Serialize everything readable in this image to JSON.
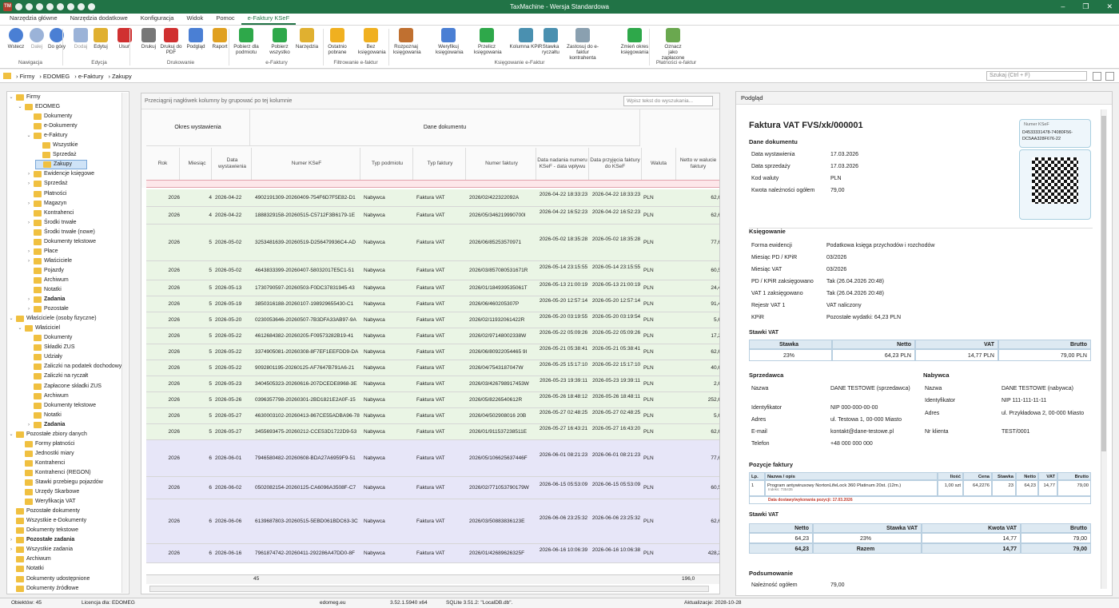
{
  "app": {
    "title": "TaxMachine - Wersja Standardowa"
  },
  "menu": [
    "Narzędzia główne",
    "Narzędzia dodatkowe",
    "Konfiguracja",
    "Widok",
    "Pomoc",
    "e-Faktury KSeF"
  ],
  "ribbon": {
    "buttons": [
      "Wstecz",
      "Dalej",
      "Do góry",
      "Dodaj",
      "Edytuj",
      "Usuń",
      "Drukuj",
      "Drukuj do PDF",
      "Podgląd",
      "Raport",
      "Pobierz dla podmiotu",
      "Pobierz wszystko",
      "Narzędzia",
      "Ostatnio pobrane",
      "Bez księgowania",
      "Rozpoznaj księgowania",
      "Weryfikuj księgowania",
      "Przelicz księgowania",
      "Kolumna KPiR",
      "Stawka ryczałtu",
      "Zastosuj do e-faktur kontrahenta",
      "Zmień okres księgowania",
      "Oznacz jako zapłacone"
    ],
    "groups": [
      "Nawigacja",
      "Edycja",
      "Drukowanie",
      "e-Faktury",
      "Filtrowanie e-faktur",
      "Księgowanie e-Faktur",
      "Płatności e-faktur"
    ]
  },
  "path": [
    "Firmy",
    "EDOMEG",
    "e-Faktury",
    "Zakupy"
  ],
  "search_placeholder": "Szukaj (Ctrl + F)",
  "tree": [
    {
      "l": "Firmy",
      "d": 0,
      "e": "v"
    },
    {
      "l": "EDOMEG",
      "d": 1,
      "e": "v"
    },
    {
      "l": "Dokumenty",
      "d": 2
    },
    {
      "l": "e-Dokumenty",
      "d": 2
    },
    {
      "l": "e-Faktury",
      "d": 2,
      "e": "v"
    },
    {
      "l": "Wszystkie",
      "d": 3
    },
    {
      "l": "Sprzedaż",
      "d": 3
    },
    {
      "l": "Zakupy",
      "d": 3,
      "sel": true
    },
    {
      "l": "Ewidencje księgowe",
      "d": 2,
      "e": ">"
    },
    {
      "l": "Sprzedaż",
      "d": 2,
      "e": ">"
    },
    {
      "l": "Płatności",
      "d": 2
    },
    {
      "l": "Magazyn",
      "d": 2,
      "e": ">"
    },
    {
      "l": "Kontrahenci",
      "d": 2
    },
    {
      "l": "Środki trwałe",
      "d": 2,
      "e": ">"
    },
    {
      "l": "Środki trwałe (nowe)",
      "d": 2
    },
    {
      "l": "Dokumenty tekstowe",
      "d": 2
    },
    {
      "l": "Płace",
      "d": 2,
      "e": ">"
    },
    {
      "l": "Właściciele",
      "d": 2,
      "e": ">"
    },
    {
      "l": "Pojazdy",
      "d": 2
    },
    {
      "l": "Archiwum",
      "d": 2
    },
    {
      "l": "Notatki",
      "d": 2
    },
    {
      "l": "Zadania",
      "d": 2,
      "e": ">",
      "b": true
    },
    {
      "l": "Pozostałe",
      "d": 2,
      "e": ">"
    },
    {
      "l": "Właściciele (osoby fizyczne)",
      "d": 0,
      "e": "v"
    },
    {
      "l": "Właściciel",
      "d": 1,
      "e": "v"
    },
    {
      "l": "Dokumenty",
      "d": 2
    },
    {
      "l": "Składki ZUS",
      "d": 2
    },
    {
      "l": "Udziały",
      "d": 2
    },
    {
      "l": "Zaliczki na podatek dochodowy",
      "d": 2
    },
    {
      "l": "Zaliczki na ryczałt",
      "d": 2
    },
    {
      "l": "Zapłacone składki ZUS",
      "d": 2
    },
    {
      "l": "Archiwum",
      "d": 2
    },
    {
      "l": "Dokumenty tekstowe",
      "d": 2
    },
    {
      "l": "Notatki",
      "d": 2
    },
    {
      "l": "Zadania",
      "d": 2,
      "e": ">",
      "b": true
    },
    {
      "l": "Pozostałe zbiory danych",
      "d": 0,
      "e": "v"
    },
    {
      "l": "Formy płatności",
      "d": 1
    },
    {
      "l": "Jednostki miary",
      "d": 1
    },
    {
      "l": "Kontrahenci",
      "d": 1
    },
    {
      "l": "Kontrahenci (REGON)",
      "d": 1
    },
    {
      "l": "Stawki przebiegu pojazdów",
      "d": 1
    },
    {
      "l": "Urzędy Skarbowe",
      "d": 1
    },
    {
      "l": "Weryfikacja VAT",
      "d": 1
    },
    {
      "l": "Pozostałe dokumenty",
      "d": 0
    },
    {
      "l": "Wszystkie e-Dokumenty",
      "d": 0
    },
    {
      "l": "Dokumenty tekstowe",
      "d": 0
    },
    {
      "l": "Pozostałe zadania",
      "d": 0,
      "e": ">",
      "b": true
    },
    {
      "l": "Wszystkie zadania",
      "d": 0,
      "e": ">"
    },
    {
      "l": "Archiwum",
      "d": 0
    },
    {
      "l": "Notatki",
      "d": 0
    },
    {
      "l": "Dokumenty udostępnione",
      "d": 0
    },
    {
      "l": "Dokumenty źródłowe",
      "d": 0
    }
  ],
  "grid": {
    "group_hint": "Przeciągnij nagłówek kolumny by grupować po tej kolumnie",
    "search_placeholder": "Wpisz tekst do wyszukania...",
    "band1": "Okres wystawienia",
    "band2": "Dane dokumentu",
    "columns": [
      "Rok",
      "Miesiąc",
      "Data wystawienia",
      "Numer KSeF",
      "Typ podmiotu",
      "Typ faktury",
      "Numer faktury",
      "Data nadania numeru KSeF - data wpływu",
      "Data przyjęcia faktury do KSeF",
      "Waluta",
      "Netto w walucie faktury"
    ],
    "rows": [
      [
        "2026",
        "4",
        "2026-04-22",
        "4902191309-20260409-754F6D7F5E82-D1",
        "Nabywca",
        "Faktura VAT",
        "2026/02/422322092A",
        "2026-04-22 18:33:23",
        "2026-04-22 18:33:23",
        "PLN",
        "62,6"
      ],
      [
        "2026",
        "4",
        "2026-04-22",
        "1888329158-20260515-C5712F3B6179-1E",
        "Nabywca",
        "Faktura VAT",
        "2026/05/346219990700I",
        "2026-04-22 16:52:23",
        "2026-04-22 16:52:23",
        "PLN",
        "62,6"
      ],
      [
        "2026",
        "5",
        "2026-05-02",
        "3253481639-20260519-D256479936C4-AD",
        "Nabywca",
        "Faktura VAT",
        "2026/06/85253570971",
        "2026-05-02 18:35:28",
        "2026-05-02 18:35:28",
        "PLN",
        "77,6"
      ],
      [
        "2026",
        "5",
        "2026-05-02",
        "4643833399-20260407-58032017E5C1-51",
        "Nabywca",
        "Faktura VAT",
        "2026/03/857080531671R",
        "2026-05-14 23:15:55",
        "2026-05-14 23:15:55",
        "PLN",
        "60,5"
      ],
      [
        "2026",
        "5",
        "2026-05-13",
        "1730790597-20260503-F0DC37831945-43",
        "Nabywca",
        "Faktura VAT",
        "2026/01/184939535061T",
        "2026-05-13 21:00:19",
        "2026-05-13 21:00:19",
        "PLN",
        "24,4"
      ],
      [
        "2026",
        "5",
        "2026-05-19",
        "3850316188-20260107-198929655430-C1",
        "Nabywca",
        "Faktura VAT",
        "2026/06/460205307P",
        "2026-05-20 12:57:14",
        "2026-05-20 12:57:14",
        "PLN",
        "91,4"
      ],
      [
        "2026",
        "5",
        "2026-05-20",
        "0230053646-20260507-7B3DFA33AB97-9A",
        "Nabywca",
        "Faktura VAT",
        "2026/02/11932061422R",
        "2026-05-20 03:19:55",
        "2026-05-20 03:19:54",
        "PLN",
        "5,6"
      ],
      [
        "2026",
        "5",
        "2026-05-22",
        "4612684382-20260205-F09573282B19-41",
        "Nabywca",
        "Faktura VAT",
        "2026/02/97148002338W",
        "2026-05-22 05:09:26",
        "2026-05-22 05:09:26",
        "PLN",
        "17,2"
      ],
      [
        "2026",
        "5",
        "2026-05-22",
        "3374905081-20260308-8F7EF1EEFDD9-DA",
        "Nabywca",
        "Faktura VAT",
        "2026/06/80922054465 9I",
        "2026-05-21 05:38:41",
        "2026-05-21 05:38:41",
        "PLN",
        "62,6"
      ],
      [
        "2026",
        "5",
        "2026-05-22",
        "9092801195-20260125-AF7647B791A6-21",
        "Nabywca",
        "Faktura VAT",
        "2026/04/7543187047W",
        "2026-05-25 15:17:10",
        "2026-05-22 15:17:10",
        "PLN",
        "40,6"
      ],
      [
        "2026",
        "5",
        "2026-05-23",
        "3404505323-20260616-207DCEDE8968-3E",
        "Nabywca",
        "Faktura VAT",
        "2026/03/426798917453W",
        "2026-05-23 19:39:11",
        "2026-05-23 19:39:11",
        "PLN",
        "2,6"
      ],
      [
        "2026",
        "5",
        "2026-05-26",
        "0396357798-20260301-2BD1821E2A0F-15",
        "Nabywca",
        "Faktura VAT",
        "2026/05/8226540612R",
        "2026-05-26 18:48:12",
        "2026-05-26 18:48:11",
        "PLN",
        "252,6"
      ],
      [
        "2026",
        "5",
        "2026-05-27",
        "4630003102-20260413-867CE55ADBA96-78",
        "Nabywca",
        "Faktura VAT",
        "2026/04/502908016 20B",
        "2026-05-27 02:48:25",
        "2026-05-27 02:48:25",
        "PLN",
        "5,6"
      ],
      [
        "2026",
        "5",
        "2026-05-27",
        "3455693475-20260212-CCE53D1722D9-53",
        "Nabywca",
        "Faktura VAT",
        "2026/01/911537238511E",
        "2026-05-27 16:43:21",
        "2026-05-27 16:43:20",
        "PLN",
        "62,6"
      ],
      [
        "2026",
        "6",
        "2026-06-01",
        "7946580482-20260608-BDA27A6959F9-51",
        "Nabywca",
        "Faktura VAT",
        "2026/05/106625637446F",
        "2026-06-01 08:21:23",
        "2026-06-01 08:21:23",
        "PLN",
        "77,6"
      ],
      [
        "2026",
        "6",
        "2026-06-02",
        "0502082154-20260125-CA6096A3508F-C7",
        "Nabywca",
        "Faktura VAT",
        "2026/02/771053790179W",
        "2026-06-15 05:53:09",
        "2026-06-15 05:53:09",
        "PLN",
        "60,5"
      ],
      [
        "2026",
        "6",
        "2026-06-06",
        "6139687803-20260515-5EBD061BDC63-3C",
        "Nabywca",
        "Faktura VAT",
        "2026/03/50883836123E",
        "2026-06-06 23:25:32",
        "2026-06-06 23:25:32",
        "PLN",
        "62,6"
      ],
      [
        "2026",
        "6",
        "2026-06-16",
        "7961874742-20260411-292286A47DD0-8F",
        "Nabywca",
        "Faktura VAT",
        "2026/01/42689626325F",
        "2026-06-16 10:06:39",
        "2026-06-16 10:06:38",
        "PLN",
        "428,2"
      ]
    ],
    "footer_count": "45",
    "footer_sum": "196,0"
  },
  "preview": {
    "panel": "Podgląd",
    "title": "Faktura VAT FVS/xk/000001",
    "ksef_label": "Numer KSeF",
    "ksef_num": "D4533331478-74080F56-DC5AA328F676-22",
    "s_dane": "Dane dokumentu",
    "dane": [
      [
        "Data wystawienia",
        "17.03.2026"
      ],
      [
        "Data sprzedaży",
        "17.03.2026"
      ],
      [
        "Kod waluty",
        "PLN"
      ],
      [
        "Kwota należności ogółem",
        "79,00"
      ]
    ],
    "s_ksieg": "Księgowanie",
    "ksieg": [
      [
        "Forma ewidencji",
        "Podatkowa księga przychodów i rozchodów"
      ],
      [
        "Miesiąc PD / KPiR",
        "03/2026"
      ],
      [
        "Miesiąc VAT",
        "03/2026"
      ],
      [
        "PD / KPiR zaksięgowano",
        "Tak (26.04.2026 20:48)"
      ],
      [
        "VAT 1 zaksięgowano",
        "Tak (26.04.2026 20:48)"
      ],
      [
        "Rejestr VAT 1",
        "VAT naliczony"
      ],
      [
        "KPiR",
        "Pozostałe wydatki: 64,23 PLN"
      ]
    ],
    "s_stawki": "Stawki VAT",
    "st_head": [
      "Stawka",
      "Netto",
      "VAT",
      "Brutto"
    ],
    "st_row": [
      "23%",
      "64,23 PLN",
      "14,77 PLN",
      "79,00 PLN"
    ],
    "s_sprz": "Sprzedawca",
    "s_nab": "Nabywca",
    "sprz": [
      [
        "Nazwa",
        "DANE TESTOWE (sprzedawca)"
      ],
      [
        "Identyfikator",
        "NIP 000-000-00-00"
      ],
      [
        "Adres",
        "ul. Testowa 1, 00-000 Miasto"
      ],
      [
        "E-mail",
        "kontakt@dane-testowe.pl"
      ],
      [
        "Telefon",
        "+48 000 000 000"
      ]
    ],
    "nab": [
      [
        "Nazwa",
        "DANE TESTOWE (nabywca)"
      ],
      [
        "Identyfikator",
        "NIP 111-111-11-11"
      ],
      [
        "Adres",
        "ul. Przykładowa 2, 00-000 Miasto"
      ],
      [
        "Nr klienta",
        "TEST/0001"
      ]
    ],
    "s_poz": "Pozycje faktury",
    "poz_head": [
      "Lp.",
      "Nazwa / opis",
      "Ilość",
      "Cena",
      "Stawka",
      "Netto",
      "VAT",
      "Brutto"
    ],
    "poz_row": [
      "1",
      "Program antywirusowy NortonLifeLock 360 Platinum 20st. (12m.)",
      "1,00 szt",
      "64,2276",
      "23",
      "64,23",
      "14,77",
      "79,00"
    ],
    "poz_index": "Indeks: 735435",
    "poz_note": "Data dostawy/wykonania pozycji: 17.03.2026",
    "s_stawki2": "Stawki VAT",
    "st2_head": [
      "Netto",
      "Stawka VAT",
      "Kwota VAT",
      "Brutto"
    ],
    "st2_row": [
      "64,23",
      "23%",
      "14,77",
      "79,00"
    ],
    "st2_sum": [
      "64,23",
      "Razem",
      "14,77",
      "79,00"
    ],
    "s_pods": "Podsumowanie",
    "pods_label": "Należność ogółem",
    "pods_val": "79,00"
  },
  "status": [
    "Obiektów: 45",
    "Licencja dla: EDOMEG",
    "edomeg.eu",
    "3.52.1.5940 x64",
    "SQLite 3.51.2: \"LocalDB.db\".",
    "Aktualizacje: 2028-10-28"
  ]
}
